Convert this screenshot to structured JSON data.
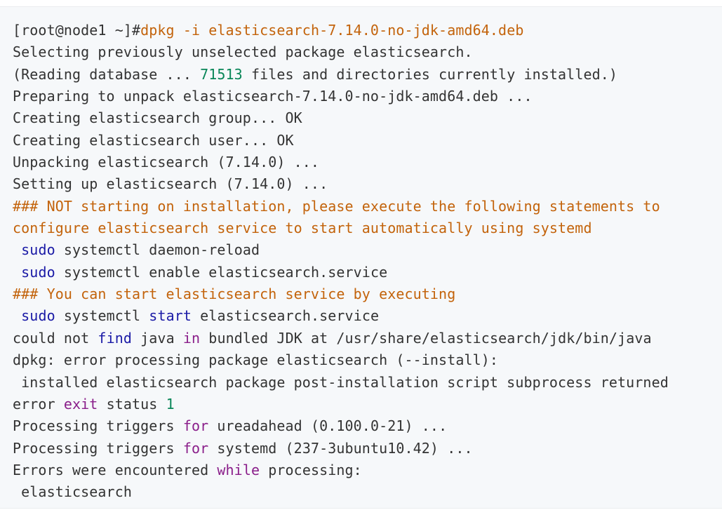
{
  "terminal": {
    "lines": [
      [
        {
          "t": "[root@node1 ~]#",
          "c": ""
        },
        {
          "t": "dpkg -i elasticsearch-7.14.0-no-jdk-amd64.deb",
          "c": "c-orange"
        }
      ],
      [
        {
          "t": "Selecting previously unselected package elasticsearch.",
          "c": ""
        }
      ],
      [
        {
          "t": "(Reading database ... ",
          "c": ""
        },
        {
          "t": "71513",
          "c": "c-num"
        },
        {
          "t": " files and directories currently installed.)",
          "c": ""
        }
      ],
      [
        {
          "t": "Preparing to unpack elasticsearch-7.14.0-no-jdk-amd64.deb ...",
          "c": ""
        }
      ],
      [
        {
          "t": "Creating elasticsearch group... OK",
          "c": ""
        }
      ],
      [
        {
          "t": "Creating elasticsearch user... OK",
          "c": ""
        }
      ],
      [
        {
          "t": "Unpacking elasticsearch (7.14.0) ...",
          "c": ""
        }
      ],
      [
        {
          "t": "Setting up elasticsearch (7.14.0) ...",
          "c": ""
        }
      ],
      [
        {
          "t": "### NOT starting on installation, please execute the following statements to",
          "c": "c-orange"
        }
      ],
      [
        {
          "t": "configure elasticsearch service to start automatically using systemd",
          "c": "c-orange"
        }
      ],
      [
        {
          "t": " ",
          "c": ""
        },
        {
          "t": "sudo",
          "c": "c-kw"
        },
        {
          "t": " systemctl daemon-reload",
          "c": ""
        }
      ],
      [
        {
          "t": " ",
          "c": ""
        },
        {
          "t": "sudo",
          "c": "c-kw"
        },
        {
          "t": " systemctl enable elasticsearch.service",
          "c": ""
        }
      ],
      [
        {
          "t": "### You can start elasticsearch service by executing",
          "c": "c-orange"
        }
      ],
      [
        {
          "t": " ",
          "c": ""
        },
        {
          "t": "sudo",
          "c": "c-kw"
        },
        {
          "t": " systemctl ",
          "c": ""
        },
        {
          "t": "start",
          "c": "c-kw"
        },
        {
          "t": " elasticsearch.service",
          "c": ""
        }
      ],
      [
        {
          "t": "could not ",
          "c": ""
        },
        {
          "t": "find",
          "c": "c-kw"
        },
        {
          "t": " java ",
          "c": ""
        },
        {
          "t": "in",
          "c": "c-purple"
        },
        {
          "t": " bundled JDK at /usr/share/elasticsearch/jdk/bin/java",
          "c": ""
        }
      ],
      [
        {
          "t": "dpkg: error processing package elasticsearch (--install):",
          "c": ""
        }
      ],
      [
        {
          "t": " installed elasticsearch package post-installation script subprocess returned",
          "c": ""
        }
      ],
      [
        {
          "t": "error ",
          "c": ""
        },
        {
          "t": "exit",
          "c": "c-purple"
        },
        {
          "t": " status ",
          "c": ""
        },
        {
          "t": "1",
          "c": "c-num"
        }
      ],
      [
        {
          "t": "Processing triggers ",
          "c": ""
        },
        {
          "t": "for",
          "c": "c-purple"
        },
        {
          "t": " ureadahead (0.100.0-21) ...",
          "c": ""
        }
      ],
      [
        {
          "t": "Processing triggers ",
          "c": ""
        },
        {
          "t": "for",
          "c": "c-purple"
        },
        {
          "t": " systemd (237-3ubuntu10.42) ...",
          "c": ""
        }
      ],
      [
        {
          "t": "Errors were encountered ",
          "c": ""
        },
        {
          "t": "while",
          "c": "c-purple"
        },
        {
          "t": " processing:",
          "c": ""
        }
      ],
      [
        {
          "t": " elasticsearch",
          "c": ""
        }
      ]
    ]
  }
}
